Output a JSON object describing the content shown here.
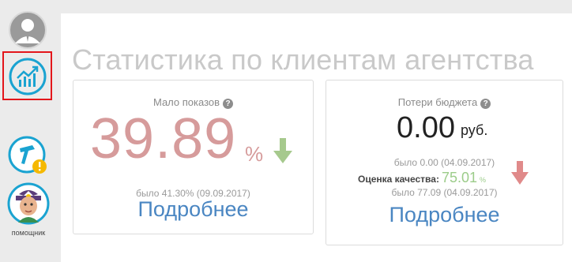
{
  "sidebar": {
    "helper_label": "помощник"
  },
  "page": {
    "title": "Статистика по клиентам агентства"
  },
  "cards": [
    {
      "title": "Мало показов",
      "help": "?",
      "value": "39.89",
      "unit": "%",
      "trend": "down",
      "trend_color": "#a6c98d",
      "previous": "было 41.30% (09.09.2017)",
      "link": "Подробнее"
    },
    {
      "title": "Потери бюджета",
      "help": "?",
      "value": "0.00",
      "unit": "руб.",
      "previous": "было 0.00 (04.09.2017)",
      "quality_label": "Оценка качества:",
      "quality_value": "75.01",
      "quality_unit": "%",
      "quality_trend": "down",
      "quality_trend_color": "#e08a8a",
      "quality_previous": "было 77.09 (04.09.2017)",
      "link": "Подробнее"
    }
  ],
  "colors": {
    "accent_link": "#4a86c2",
    "negative_value": "#d69b9b",
    "positive_value": "#9ccc8a",
    "highlight_border": "#e3161b"
  }
}
